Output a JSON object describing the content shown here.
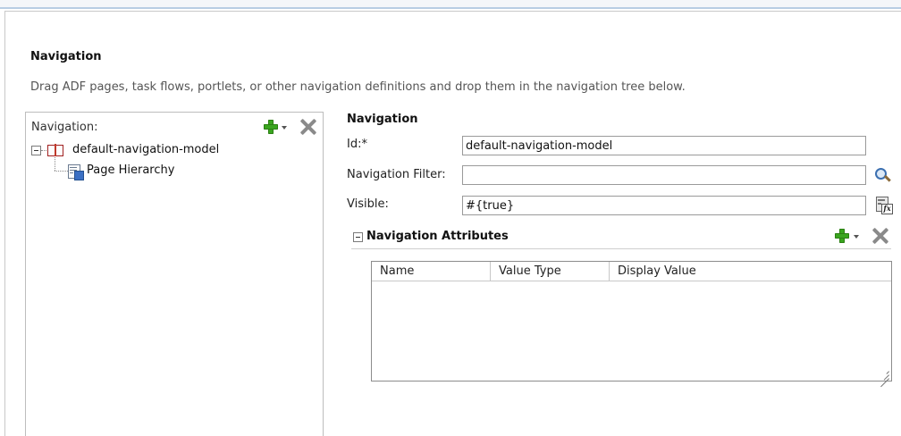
{
  "section": {
    "title": "Navigation",
    "description": "Drag ADF pages, task flows, portlets, or other navigation definitions and drop them in the navigation tree below."
  },
  "tree": {
    "header_label": "Navigation:",
    "add_icon": "add-icon",
    "delete_icon": "delete-icon",
    "nodes": [
      {
        "label": "default-navigation-model",
        "icon": "book-icon",
        "expanded": true
      },
      {
        "label": "Page Hierarchy",
        "icon": "page-hierarchy-icon"
      }
    ]
  },
  "form": {
    "title": "Navigation",
    "id_label": "Id:*",
    "id_value": "default-navigation-model",
    "filter_label": "Navigation Filter:",
    "filter_value": "",
    "visible_label": "Visible:",
    "visible_value": "#{true}"
  },
  "attributes": {
    "title": "Navigation Attributes",
    "columns": [
      "Name",
      "Value Type",
      "Display Value"
    ],
    "rows": []
  },
  "colors": {
    "accent_line": "#b8cde3",
    "add_green": "#3aa51f",
    "delete_gray": "#8a8a8a"
  }
}
